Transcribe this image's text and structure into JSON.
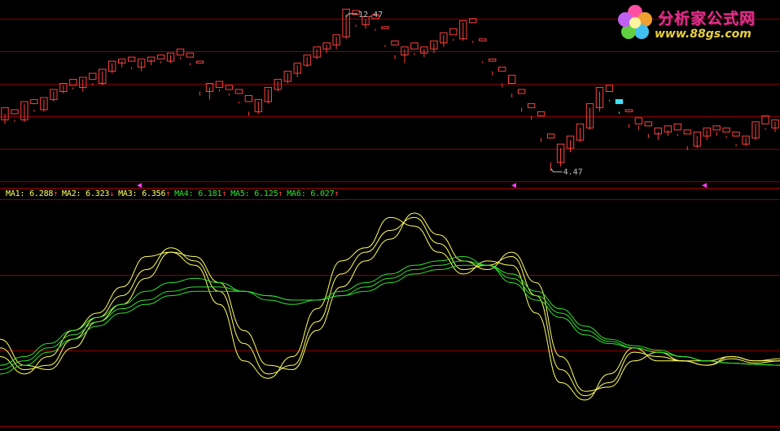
{
  "chart_data": [
    {
      "type": "candlestick",
      "high_label": "12.47",
      "low_label": "4.47",
      "up_color": "#ff4040",
      "down_color": "#40e0ff",
      "candles": [
        [
          7.0,
          7.6,
          6.8,
          7.3
        ],
        [
          7.3,
          7.5,
          6.9,
          7.0
        ],
        [
          7.0,
          7.9,
          6.9,
          7.8
        ],
        [
          7.8,
          8.0,
          7.4,
          7.5
        ],
        [
          7.5,
          8.1,
          7.4,
          8.0
        ],
        [
          8.0,
          8.5,
          7.9,
          8.4
        ],
        [
          8.4,
          8.8,
          8.3,
          8.7
        ],
        [
          8.7,
          9.0,
          8.5,
          8.6
        ],
        [
          8.6,
          9.1,
          8.4,
          9.0
        ],
        [
          9.0,
          9.3,
          8.7,
          8.8
        ],
        [
          8.8,
          9.5,
          8.7,
          9.4
        ],
        [
          9.4,
          9.9,
          9.3,
          9.8
        ],
        [
          9.8,
          10.0,
          9.6,
          9.9
        ],
        [
          9.9,
          10.1,
          9.5,
          9.6
        ],
        [
          9.6,
          10.0,
          9.4,
          9.9
        ],
        [
          9.9,
          10.1,
          9.7,
          10.0
        ],
        [
          10.0,
          10.2,
          9.8,
          9.9
        ],
        [
          9.9,
          10.3,
          9.8,
          10.2
        ],
        [
          10.2,
          10.5,
          10.0,
          10.1
        ],
        [
          10.1,
          10.3,
          9.7,
          9.8
        ],
        [
          9.8,
          9.9,
          8.2,
          8.4
        ],
        [
          8.4,
          8.8,
          8.0,
          8.6
        ],
        [
          8.6,
          8.9,
          8.4,
          8.5
        ],
        [
          8.5,
          8.7,
          8.2,
          8.3
        ],
        [
          8.3,
          8.5,
          7.8,
          7.9
        ],
        [
          7.9,
          8.2,
          7.2,
          7.4
        ],
        [
          7.4,
          8.0,
          7.3,
          7.9
        ],
        [
          7.9,
          8.6,
          7.8,
          8.5
        ],
        [
          8.5,
          9.0,
          8.4,
          8.9
        ],
        [
          8.9,
          9.4,
          8.8,
          9.3
        ],
        [
          9.3,
          9.8,
          9.1,
          9.7
        ],
        [
          9.7,
          10.2,
          9.6,
          10.1
        ],
        [
          10.1,
          10.6,
          10.0,
          10.5
        ],
        [
          10.5,
          10.8,
          10.3,
          10.7
        ],
        [
          10.7,
          11.2,
          10.5,
          11.1
        ],
        [
          11.1,
          12.47,
          11.0,
          12.2
        ],
        [
          12.2,
          12.4,
          11.6,
          11.7
        ],
        [
          11.7,
          12.1,
          11.5,
          12.0
        ],
        [
          12.0,
          12.2,
          11.4,
          11.5
        ],
        [
          11.5,
          11.6,
          10.6,
          10.7
        ],
        [
          10.7,
          10.9,
          10.0,
          10.2
        ],
        [
          10.2,
          10.6,
          9.8,
          10.5
        ],
        [
          10.5,
          10.8,
          10.2,
          10.3
        ],
        [
          10.3,
          10.6,
          10.1,
          10.5
        ],
        [
          10.5,
          10.9,
          10.3,
          10.8
        ],
        [
          10.8,
          11.3,
          10.6,
          11.2
        ],
        [
          11.2,
          11.5,
          10.9,
          11.0
        ],
        [
          11.0,
          11.9,
          10.9,
          11.8
        ],
        [
          11.8,
          12.0,
          10.8,
          10.9
        ],
        [
          10.9,
          11.0,
          9.8,
          9.9
        ],
        [
          9.9,
          10.0,
          9.2,
          9.4
        ],
        [
          9.4,
          9.6,
          8.6,
          8.8
        ],
        [
          8.8,
          9.2,
          8.1,
          8.3
        ],
        [
          8.3,
          8.5,
          7.4,
          7.6
        ],
        [
          7.6,
          7.8,
          7.0,
          7.2
        ],
        [
          7.2,
          7.4,
          5.9,
          6.1
        ],
        [
          6.1,
          6.3,
          4.47,
          4.9
        ],
        [
          4.9,
          5.8,
          4.7,
          5.6
        ],
        [
          5.6,
          6.2,
          5.4,
          6.0
        ],
        [
          6.0,
          6.8,
          5.9,
          6.6
        ],
        [
          6.6,
          7.8,
          6.5,
          7.6
        ],
        [
          7.6,
          8.6,
          7.4,
          8.4
        ],
        [
          8.4,
          8.7,
          7.9,
          8.0
        ],
        [
          8.0,
          7.8,
          7.3,
          7.4
        ],
        [
          7.4,
          7.5,
          6.6,
          6.8
        ],
        [
          6.8,
          7.1,
          6.5,
          6.7
        ],
        [
          6.7,
          6.9,
          6.1,
          6.3
        ],
        [
          6.3,
          6.6,
          6.0,
          6.4
        ],
        [
          6.4,
          6.7,
          6.2,
          6.5
        ],
        [
          6.5,
          6.8,
          6.2,
          6.3
        ],
        [
          6.3,
          6.5,
          5.5,
          5.7
        ],
        [
          5.7,
          6.4,
          5.6,
          6.2
        ],
        [
          6.2,
          6.6,
          6.0,
          6.5
        ],
        [
          6.5,
          6.7,
          6.2,
          6.4
        ],
        [
          6.4,
          6.6,
          6.1,
          6.2
        ],
        [
          6.2,
          6.4,
          5.7,
          5.8
        ],
        [
          5.8,
          6.2,
          5.7,
          6.1
        ],
        [
          6.1,
          6.9,
          6.0,
          6.8
        ],
        [
          6.8,
          7.2,
          6.5,
          6.6
        ],
        [
          6.6,
          7.0,
          6.4,
          6.9
        ]
      ]
    },
    {
      "type": "line",
      "series": [
        {
          "name": "MA1",
          "value_label": "6.288",
          "arrow": "↑",
          "color": "#ffff60",
          "values": [
            3.6,
            3.2,
            3.6,
            4.2,
            4.6,
            5.2,
            5.9,
            6.0,
            5.7,
            4.8,
            3.5,
            3.1,
            3.6,
            4.7,
            5.8,
            6.1,
            6.8,
            6.6,
            6.0,
            5.5,
            5.8,
            5.7,
            4.6,
            3.0,
            2.6,
            3.2,
            3.8,
            3.5,
            3.5,
            3.5,
            3.6,
            3.5,
            3.5
          ]
        },
        {
          "name": "MA2",
          "value_label": "6.323",
          "arrow": "↓",
          "color": "#ffff60",
          "values": [
            3.8,
            3.3,
            3.4,
            4.0,
            4.5,
            5.0,
            5.6,
            6.1,
            5.8,
            5.1,
            3.9,
            3.2,
            3.4,
            4.4,
            5.5,
            6.0,
            6.5,
            6.8,
            6.2,
            5.6,
            5.7,
            5.9,
            5.0,
            3.3,
            2.7,
            3.0,
            3.7,
            3.6,
            3.5,
            3.4,
            3.6,
            3.5,
            3.55
          ]
        },
        {
          "name": "MA3",
          "value_label": "6.356",
          "arrow": "↑",
          "color": "#ffff60",
          "values": [
            4.0,
            3.4,
            3.3,
            3.8,
            4.4,
            4.8,
            5.4,
            6.0,
            5.9,
            5.3,
            4.2,
            3.4,
            3.3,
            4.2,
            5.2,
            5.8,
            6.3,
            6.9,
            6.4,
            5.8,
            5.6,
            6.0,
            5.3,
            3.6,
            2.8,
            2.9,
            3.5,
            3.7,
            3.5,
            3.4,
            3.55,
            3.45,
            3.5
          ]
        },
        {
          "name": "MA4",
          "value_label": "6.181",
          "arrow": "↑",
          "color": "#30e030",
          "values": [
            3.4,
            3.6,
            3.9,
            4.2,
            4.5,
            4.8,
            5.1,
            5.3,
            5.4,
            5.3,
            5.1,
            4.9,
            4.8,
            4.9,
            5.1,
            5.3,
            5.5,
            5.7,
            5.8,
            5.9,
            5.7,
            5.3,
            4.9,
            4.5,
            4.1,
            3.9,
            3.8,
            3.7,
            3.6,
            3.5,
            3.45,
            3.42,
            3.4
          ]
        },
        {
          "name": "MA5",
          "value_label": "6.125",
          "arrow": "↑",
          "color": "#30e030",
          "values": [
            3.3,
            3.5,
            3.8,
            4.1,
            4.4,
            4.7,
            4.9,
            5.1,
            5.2,
            5.2,
            5.1,
            5.0,
            4.9,
            4.9,
            5.0,
            5.2,
            5.4,
            5.6,
            5.7,
            5.8,
            5.7,
            5.4,
            5.0,
            4.6,
            4.2,
            3.95,
            3.8,
            3.7,
            3.6,
            3.5,
            3.45,
            3.42,
            3.4
          ]
        },
        {
          "name": "MA6",
          "value_label": "6.027",
          "arrow": "↑",
          "color": "#30e030",
          "values": [
            3.2,
            3.4,
            3.7,
            4.0,
            4.3,
            4.6,
            4.8,
            5.0,
            5.1,
            5.1,
            5.1,
            5.0,
            4.9,
            4.9,
            5.0,
            5.1,
            5.3,
            5.5,
            5.6,
            5.7,
            5.7,
            5.5,
            5.1,
            4.7,
            4.3,
            4.0,
            3.85,
            3.75,
            3.6,
            3.5,
            3.45,
            3.42,
            3.4
          ]
        }
      ]
    }
  ],
  "legend_sep": ": ",
  "logo": {
    "title": "分析家公式网",
    "url": "www.88gs.com"
  },
  "colors": {
    "grid": "#8b0000",
    "divider": "#a00000",
    "marker": "#ff40ff",
    "annotation": "#c0c0c0"
  }
}
